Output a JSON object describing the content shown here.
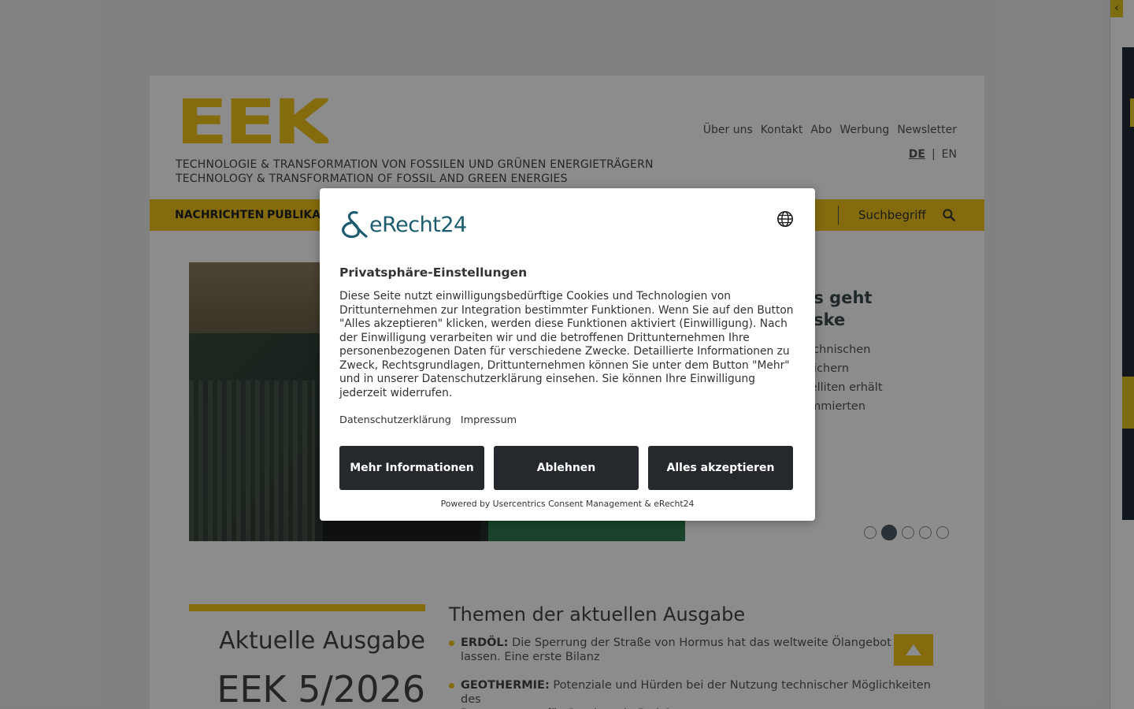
{
  "site": {
    "logo": "EEK",
    "tagline_de": "TECHNOLOGIE & TRANSFORMATION VON FOSSILEN UND GRÜNEN ENERGIETRÄGERN",
    "tagline_en": "TECHNOLOGY & TRANSFORMATION OF FOSSIL AND GREEN ENERGIES"
  },
  "topnav": [
    "Über uns",
    "Kontakt",
    "Abo",
    "Werbung",
    "Newsletter"
  ],
  "lang": {
    "de": "DE",
    "sep": "|",
    "en": "EN"
  },
  "mainnav": {
    "item1": "NACHRICHTEN",
    "item2": "PUBLIKAT",
    "search_placeholder": "Suchbegriff"
  },
  "hero": {
    "title": "us-Preis geht\nmin Haske",
    "text": "n umwelttechnischen\nergrundspeichern\nen und Satelliten erhält\ne den renommierten\neis."
  },
  "slider": {
    "count": 5,
    "active": 2
  },
  "issue": {
    "label": "Aktuelle Ausgabe",
    "number": "EEK 5/2026"
  },
  "themes": {
    "title": "Themen der aktuellen Ausgabe",
    "items": [
      {
        "tag": "ERDÖL:",
        "text": " Die Sperrung der Straße von Hormus hat das weltweite Ölangebot einb\nlassen. Eine erste Bilanz"
      },
      {
        "tag": "GEOTHERMIE:",
        "text": "  Potenziale und Hürden bei der Nutzung technischer Möglichkeiten des\nDatenzugangs für Geothermie-Projekte"
      }
    ]
  },
  "consent": {
    "brand": "eRecht24",
    "title": "Privatsphäre-Einstellungen",
    "text": "Diese Seite nutzt einwilligungsbedürftige Cookies und Technologien von Drittunternehmen zur Integration bestimmter Funktionen. Wenn Sie auf den Button \"Alles akzeptieren\" klicken, werden diese Funktionen aktiviert (Einwilligung). Nach der Einwilligung verarbeiten wir und die betroffenen Drittunternehmen Ihre personenbezogenen Daten für verschiedene Zwecke. Detaillierte Informationen zu Zweck, Rechtsgrundlagen, Drittunternehmen können Sie unter dem Button \"Mehr\" und in unserer Datenschutzerklärung einsehen. Sie können Ihre Einwilligung jederzeit widerrufen.",
    "link_privacy": "Datenschutzerklärung",
    "link_imprint": "Impressum",
    "btn_more": "Mehr Informationen",
    "btn_deny": "Ablehnen",
    "btn_accept": "Alles akzeptieren",
    "powered": "Powered by Usercentrics Consent Management & eRecht24"
  },
  "colors": {
    "accent": "#f0c419",
    "button": "#25292d",
    "brand_teal": "#1d5c6f"
  }
}
